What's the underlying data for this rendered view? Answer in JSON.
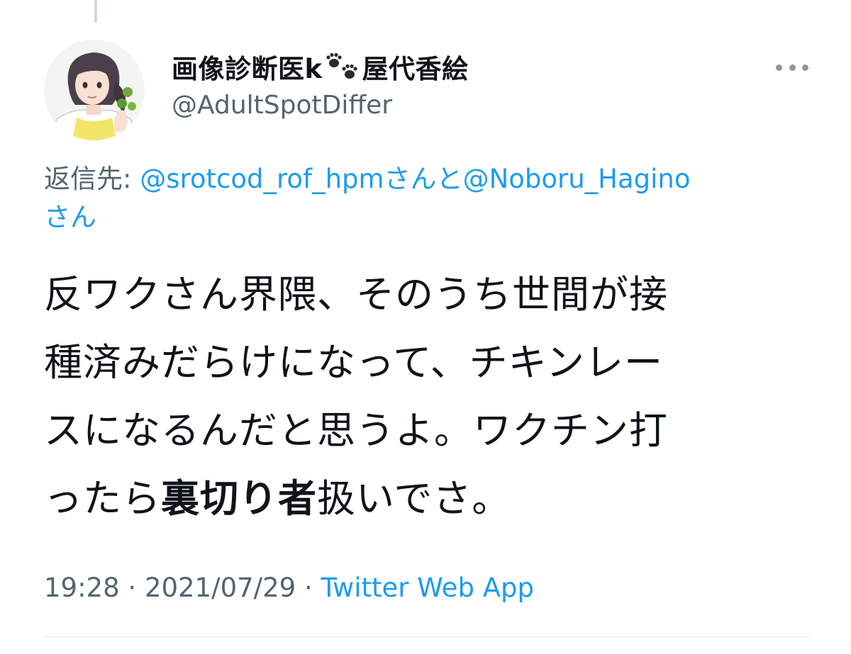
{
  "tweet": {
    "author": {
      "display_name_prefix": "画像診断医k",
      "display_name_suffix": "屋代香絵",
      "name_emoji": "paw-prints",
      "handle": "@AdultSpotDiffer",
      "avatar": "illustrated-doctor-avatar"
    },
    "more_icon": "more-horizontal-icon",
    "reply": {
      "label": "返信先: ",
      "mention_1": "@srotcod_rof_hpm",
      "connector": "さんと",
      "mention_2": "@Noboru_Hagino",
      "suffix": "さん"
    },
    "text": {
      "line_1": "反ワクさん界隈、そのうち世間が接",
      "line_2": "種済みだらけになって、チキンレー",
      "line_3": "スになるんだと思うよ。ワクチン打",
      "line_4_before": "ったら",
      "line_4_bold": "裏切り者",
      "line_4_after": "扱いでさ。"
    },
    "meta": {
      "time": "19:28",
      "separator_1": " · ",
      "date": "2021/07/29",
      "separator_2": " · ",
      "source": "Twitter Web App"
    }
  },
  "colors": {
    "text_primary": "#0f1419",
    "text_secondary": "#536471",
    "link": "#1d9bf0",
    "divider": "#eff3f4"
  }
}
